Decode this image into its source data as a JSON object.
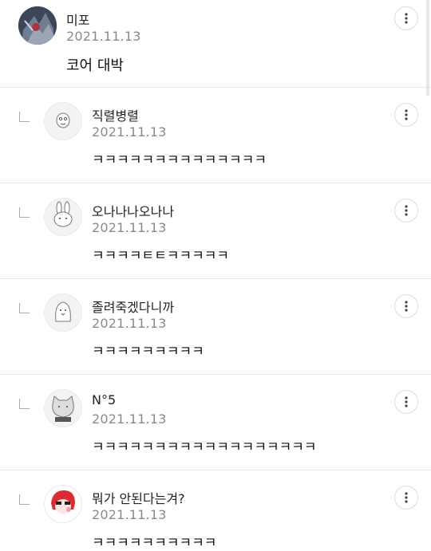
{
  "comments": [
    {
      "name": "미포",
      "date": "2021.11.13",
      "text": "코어 대박"
    },
    {
      "name": "직렬병렬",
      "date": "2021.11.13",
      "text": "ㅋㅋㅋㅋㅋㅋㅋㅋㅋㅋㅋㅋㅋㅋ"
    },
    {
      "name": "오나나나오나나",
      "date": "2021.11.13",
      "text": "ㅋㅋㅋㅋㅌㅌㅋㅋㅋㅋㅋ"
    },
    {
      "name": "졸려죽겠다니까",
      "date": "2021.11.13",
      "text": "ㅋㅋㅋㅋㅋㅋㅋㅋㅋ"
    },
    {
      "name": "N°5",
      "date": "2021.11.13",
      "text": "ㅋㅋㅋㅋㅋㅋㅋㅋㅋㅋㅋㅋㅋㅋㅋㅋㅋㅋ"
    },
    {
      "name": "뭐가 안된다는겨?",
      "date": "2021.11.13",
      "text": "ㅋㅋㅋㅋㅋㅋㅋㅋㅋㅋ"
    }
  ],
  "icons": {
    "more": "more-vertical-icon",
    "reply": "reply-indent-icon"
  }
}
